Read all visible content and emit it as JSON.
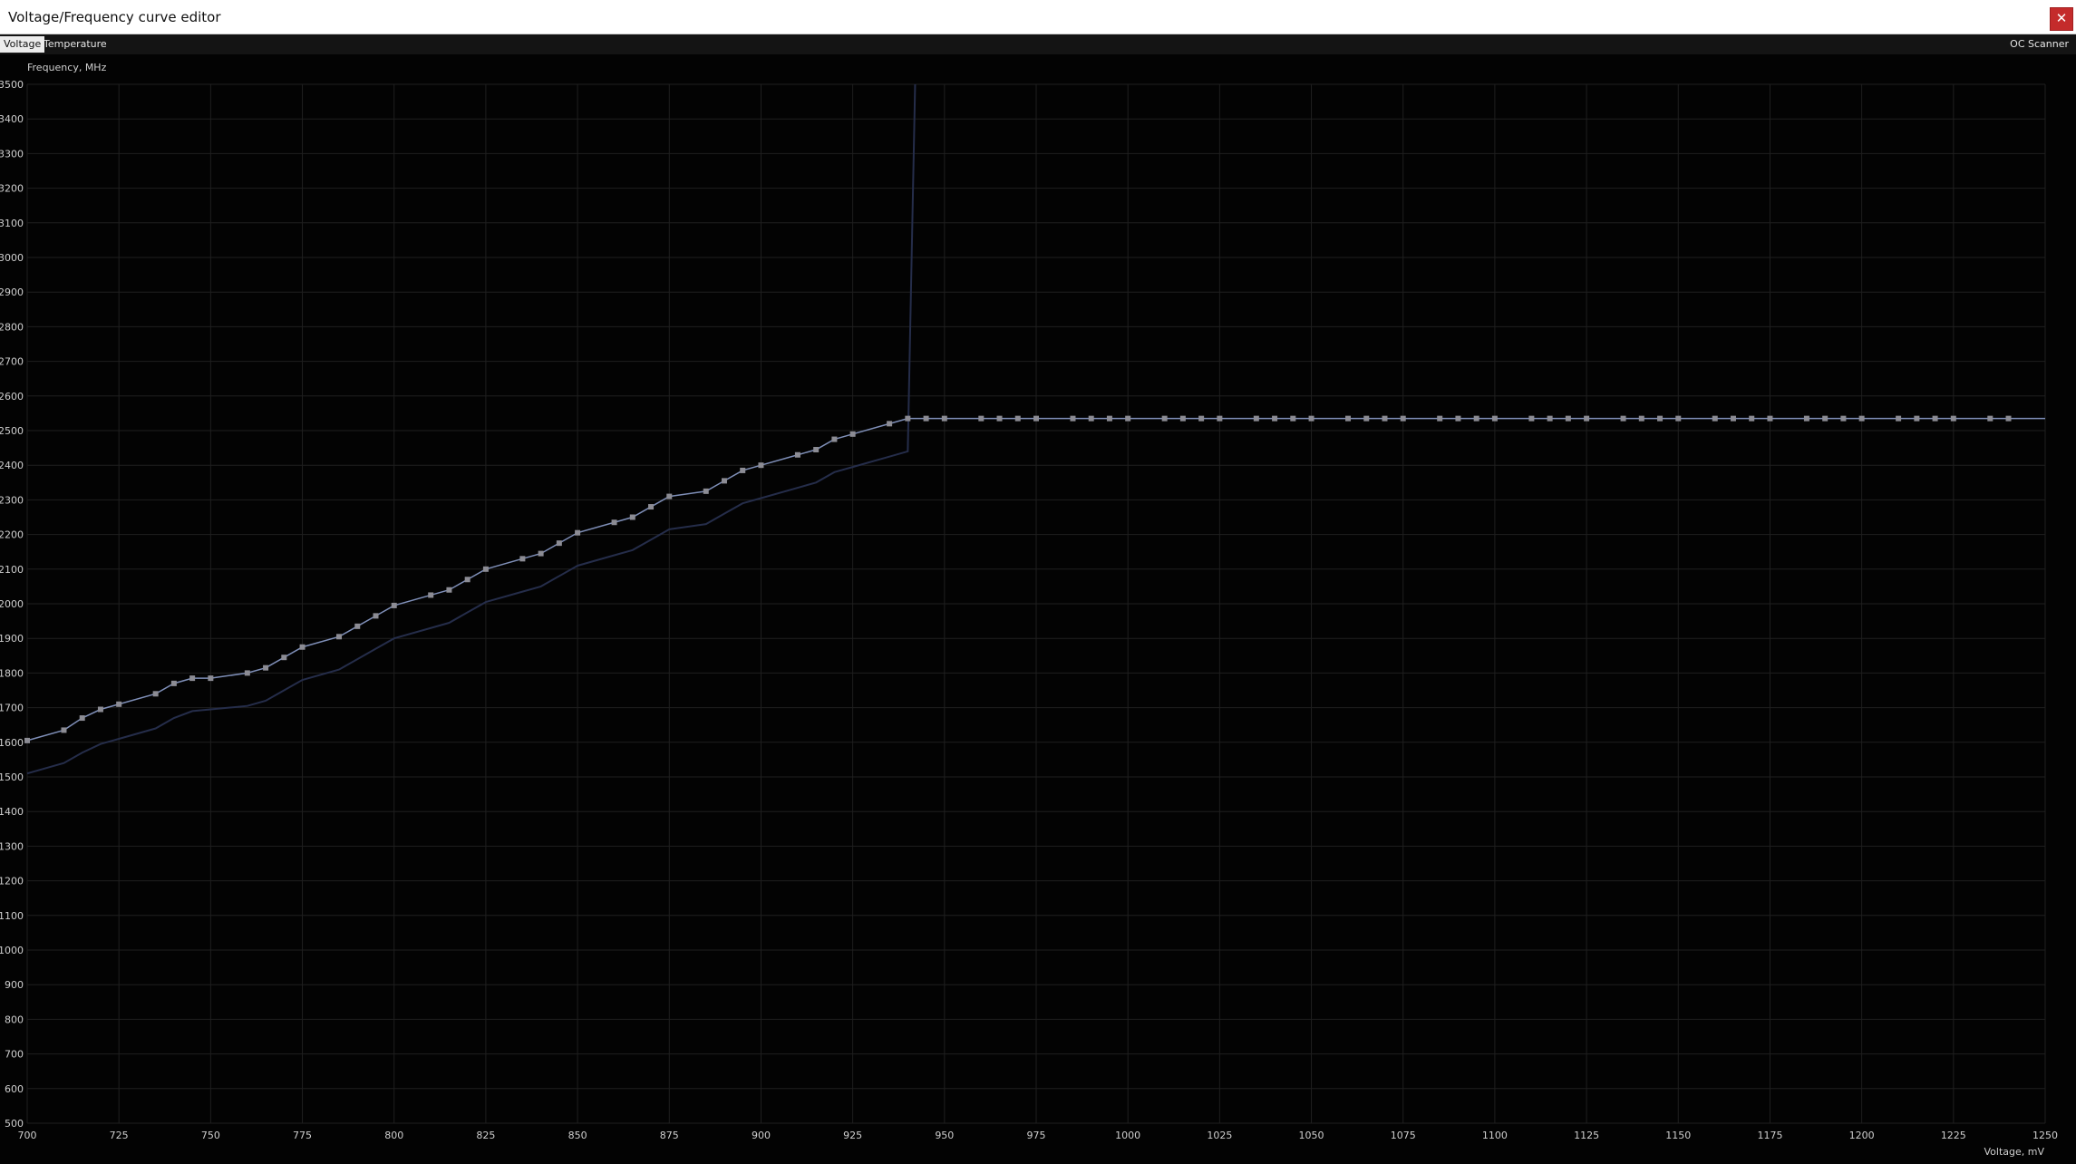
{
  "window": {
    "title": "Voltage/Frequency curve editor",
    "close_glyph": "✕"
  },
  "tabs": {
    "voltage": "Voltage",
    "temperature": "Temperature",
    "oc_scanner": "OC Scanner",
    "active": "voltage"
  },
  "colors": {
    "background": "#030303",
    "grid": "#1f1f1f",
    "curve": "#7f8fb8",
    "point": "#8c8c94",
    "baseline_curve": "#252d4a",
    "close_button": "#c42b2b"
  },
  "chart_data": {
    "type": "line",
    "xlabel": "Voltage, mV",
    "ylabel": "Frequency, MHz",
    "xlim": [
      700,
      1250
    ],
    "ylim": [
      500,
      3500
    ],
    "x_ticks": [
      700,
      725,
      750,
      775,
      800,
      825,
      850,
      875,
      900,
      925,
      950,
      975,
      1000,
      1025,
      1050,
      1075,
      1100,
      1125,
      1150,
      1175,
      1200,
      1225,
      1250
    ],
    "y_ticks": [
      500,
      600,
      700,
      800,
      900,
      1000,
      1100,
      1200,
      1300,
      1400,
      1500,
      1600,
      1700,
      1800,
      1900,
      2000,
      2100,
      2200,
      2300,
      2400,
      2500,
      2600,
      2700,
      2800,
      2900,
      3000,
      3100,
      3200,
      3300,
      3400,
      3500
    ],
    "grid": true,
    "series": [
      {
        "role": "curve-points",
        "x": [
          700,
          710,
          715,
          720,
          725,
          735,
          740,
          745,
          750,
          760,
          765,
          770,
          775,
          785,
          790,
          795,
          800,
          810,
          815,
          820,
          825,
          835,
          840,
          845,
          850,
          860,
          865,
          870,
          875,
          885,
          890,
          895,
          900,
          910,
          915,
          920,
          925,
          935,
          940,
          945,
          950,
          960,
          965,
          970,
          975,
          985,
          990,
          995,
          1000,
          1010,
          1015,
          1020,
          1025,
          1035,
          1040,
          1045,
          1050,
          1060,
          1065,
          1070,
          1075,
          1085,
          1090,
          1095,
          1100,
          1110,
          1115,
          1120,
          1125,
          1135,
          1140,
          1145,
          1150,
          1160,
          1165,
          1170,
          1175,
          1185,
          1190,
          1195,
          1200,
          1210,
          1215,
          1220,
          1225,
          1235,
          1240
        ],
        "y": [
          1605,
          1635,
          1670,
          1695,
          1710,
          1740,
          1770,
          1785,
          1785,
          1800,
          1815,
          1845,
          1875,
          1905,
          1935,
          1965,
          1995,
          2025,
          2040,
          2070,
          2100,
          2130,
          2145,
          2175,
          2205,
          2235,
          2250,
          2280,
          2310,
          2325,
          2355,
          2385,
          2400,
          2430,
          2445,
          2475,
          2490,
          2520,
          2535,
          2535,
          2535,
          2535,
          2535,
          2535,
          2535,
          2535,
          2535,
          2535,
          2535,
          2535,
          2535,
          2535,
          2535,
          2535,
          2535,
          2535,
          2535,
          2535,
          2535,
          2535,
          2535,
          2535,
          2535,
          2535,
          2535,
          2535,
          2535,
          2535,
          2535,
          2535,
          2535,
          2535,
          2535,
          2535,
          2535,
          2535,
          2535,
          2535,
          2535,
          2535,
          2535,
          2535,
          2535,
          2535,
          2535,
          2535,
          2535
        ]
      },
      {
        "role": "baseline-curve",
        "x": [
          700,
          710,
          715,
          720,
          725,
          735,
          740,
          745,
          750,
          760,
          765,
          770,
          775,
          785,
          790,
          795,
          800,
          810,
          815,
          820,
          825,
          835,
          840,
          845,
          850,
          860,
          865,
          870,
          875,
          885,
          890,
          895,
          900,
          910,
          915,
          920,
          925,
          935,
          940,
          942
        ],
        "y": [
          1510,
          1540,
          1570,
          1595,
          1610,
          1640,
          1670,
          1690,
          1695,
          1705,
          1720,
          1750,
          1780,
          1810,
          1840,
          1870,
          1900,
          1930,
          1945,
          1975,
          2005,
          2035,
          2050,
          2080,
          2110,
          2140,
          2155,
          2185,
          2215,
          2230,
          2260,
          2290,
          2305,
          2335,
          2350,
          2380,
          2395,
          2425,
          2440,
          3500
        ]
      }
    ]
  }
}
